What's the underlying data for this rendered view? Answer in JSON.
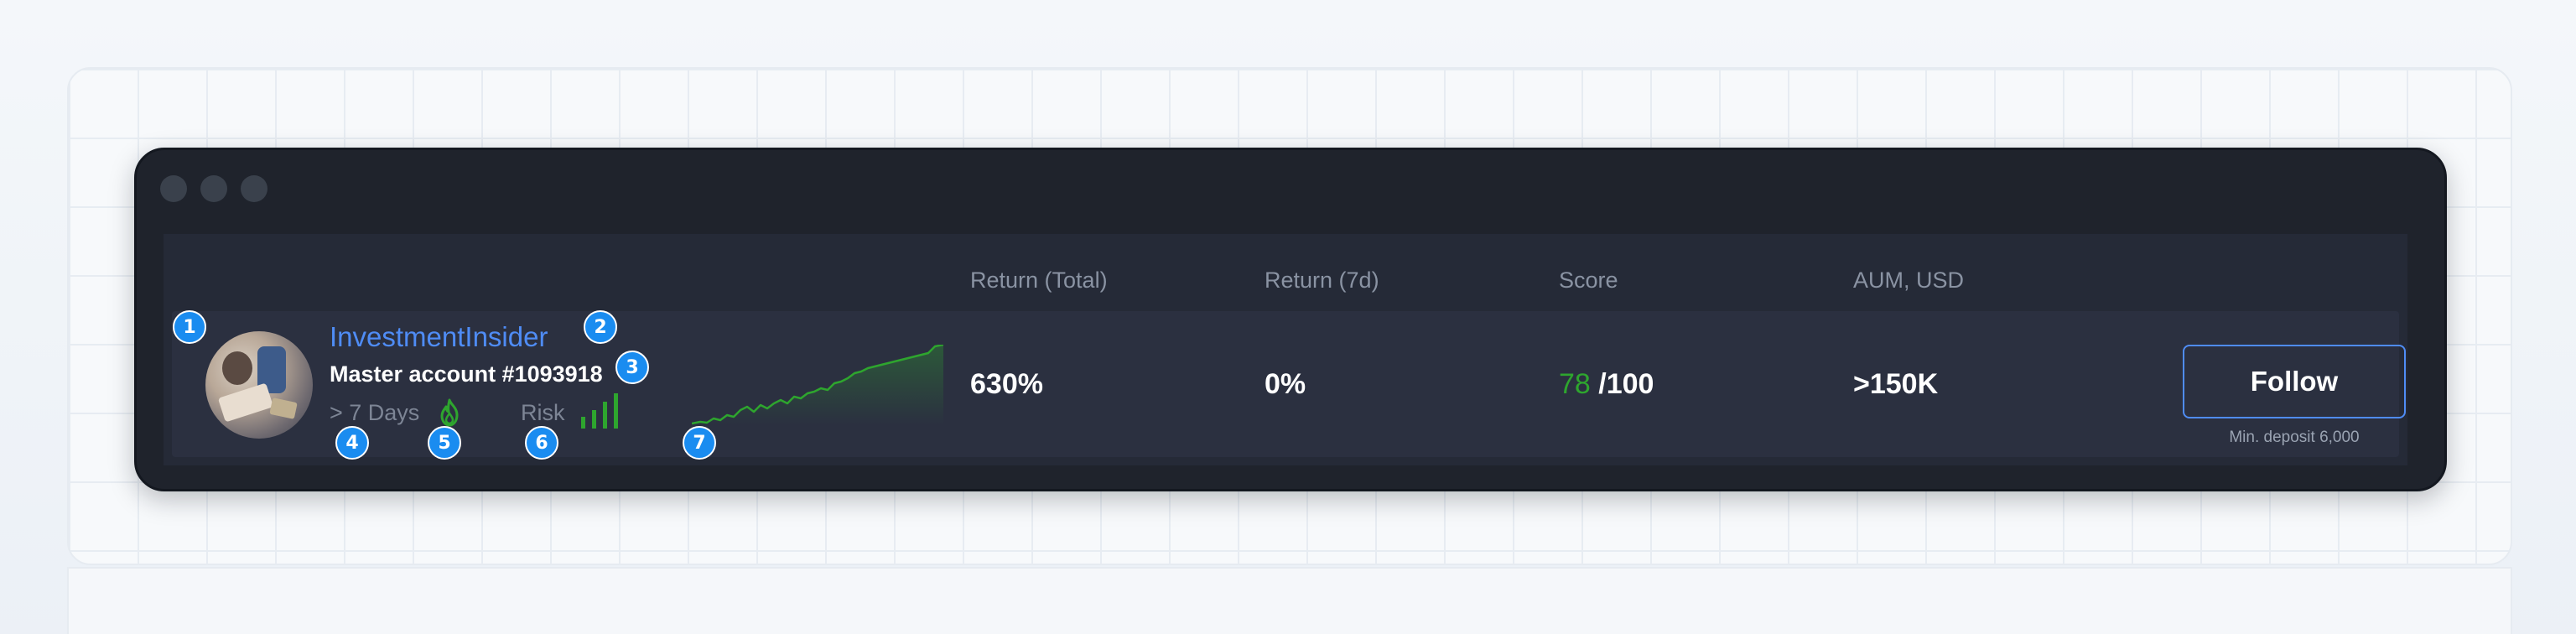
{
  "columns": {
    "return_total": "Return (Total)",
    "return_7d": "Return (7d)",
    "score": "Score",
    "aum": "AUM, USD"
  },
  "trader": {
    "name": "InvestmentInsider",
    "account": "Master account #1093918",
    "age": "> 7 Days",
    "risk_label": "Risk",
    "risk_level": 4,
    "risk_levels_total": 4,
    "return_total": "630%",
    "return_7d": "0%",
    "score_value": "78",
    "score_max": "/100",
    "aum": ">150K"
  },
  "follow": {
    "label": "Follow",
    "min_deposit": "Min. deposit 6,000"
  },
  "markers": [
    "1",
    "2",
    "3",
    "4",
    "5",
    "6",
    "7"
  ],
  "colors": {
    "window_bg": "#1f232c",
    "row_bg": "#2b3040",
    "accent_blue": "#4f8cf5",
    "accent_green": "#2ea52e",
    "marker_blue": "#1a8cf0"
  },
  "icons": {
    "fire": "fire-icon",
    "risk": "signal-bars-icon"
  }
}
